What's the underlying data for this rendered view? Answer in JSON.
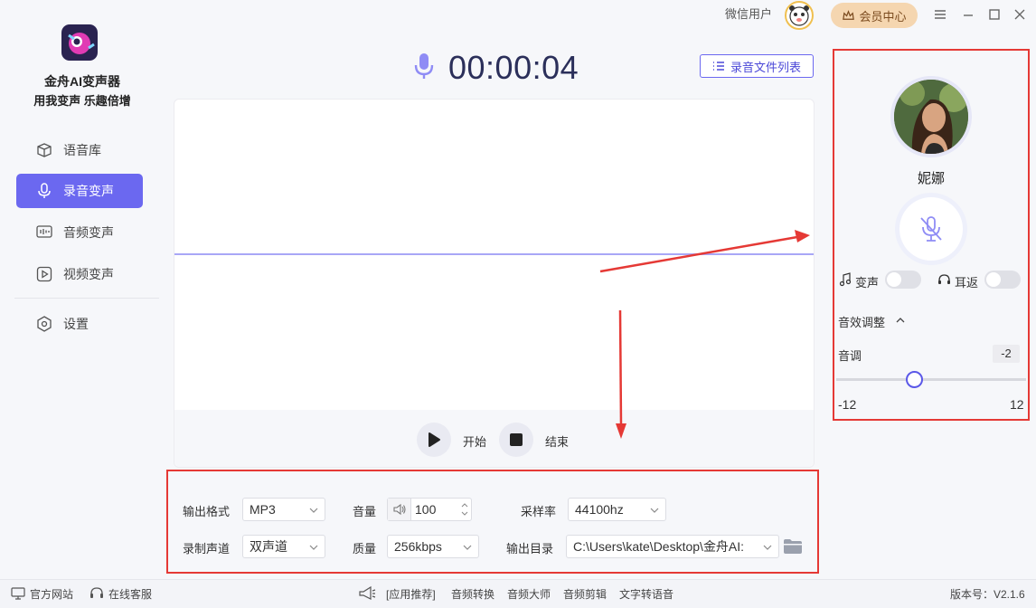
{
  "app": {
    "name": "金舟AI变声器",
    "slogan": "用我变声 乐趣倍增"
  },
  "sidebar": {
    "items": [
      {
        "label": "语音库",
        "icon": "cube-icon",
        "active": false
      },
      {
        "label": "录音变声",
        "icon": "mic-icon",
        "active": true
      },
      {
        "label": "音频变声",
        "icon": "audio-wave-icon",
        "active": false
      },
      {
        "label": "视频变声",
        "icon": "play-icon",
        "active": false
      }
    ],
    "settings_label": "设置"
  },
  "header": {
    "user_label": "微信用户",
    "vip_label": "会员中心"
  },
  "recorder": {
    "timer": "00:00:04",
    "file_list_label": "录音文件列表",
    "start_label": "开始",
    "stop_label": "结束"
  },
  "output_settings": {
    "format_label": "输出格式",
    "format_value": "MP3",
    "volume_label": "音量",
    "volume_value": "100",
    "sample_rate_label": "采样率",
    "sample_rate_value": "44100hz",
    "channel_label": "录制声道",
    "channel_value": "双声道",
    "quality_label": "质量",
    "quality_value": "256kbps",
    "output_dir_label": "输出目录",
    "output_dir_value": "C:\\Users\\kate\\Desktop\\金舟AI:"
  },
  "voice_panel": {
    "voice_name": "妮娜",
    "voice_change_label": "变声",
    "voice_change_on": false,
    "monitor_label": "耳返",
    "monitor_on": false,
    "effects_label": "音效调整",
    "pitch_label": "音调",
    "pitch_value": "-2",
    "pitch_min": "-12",
    "pitch_max": "12"
  },
  "footer": {
    "website_label": "官方网站",
    "support_label": "在线客服",
    "recommend_label": "[应用推荐]",
    "links": [
      "音频转换",
      "音频大师",
      "音频剪辑",
      "文字转语音"
    ],
    "version_label": "版本号：V2.1.6"
  },
  "colors": {
    "accent": "#6b68f0",
    "highlight_box": "#e53935"
  }
}
